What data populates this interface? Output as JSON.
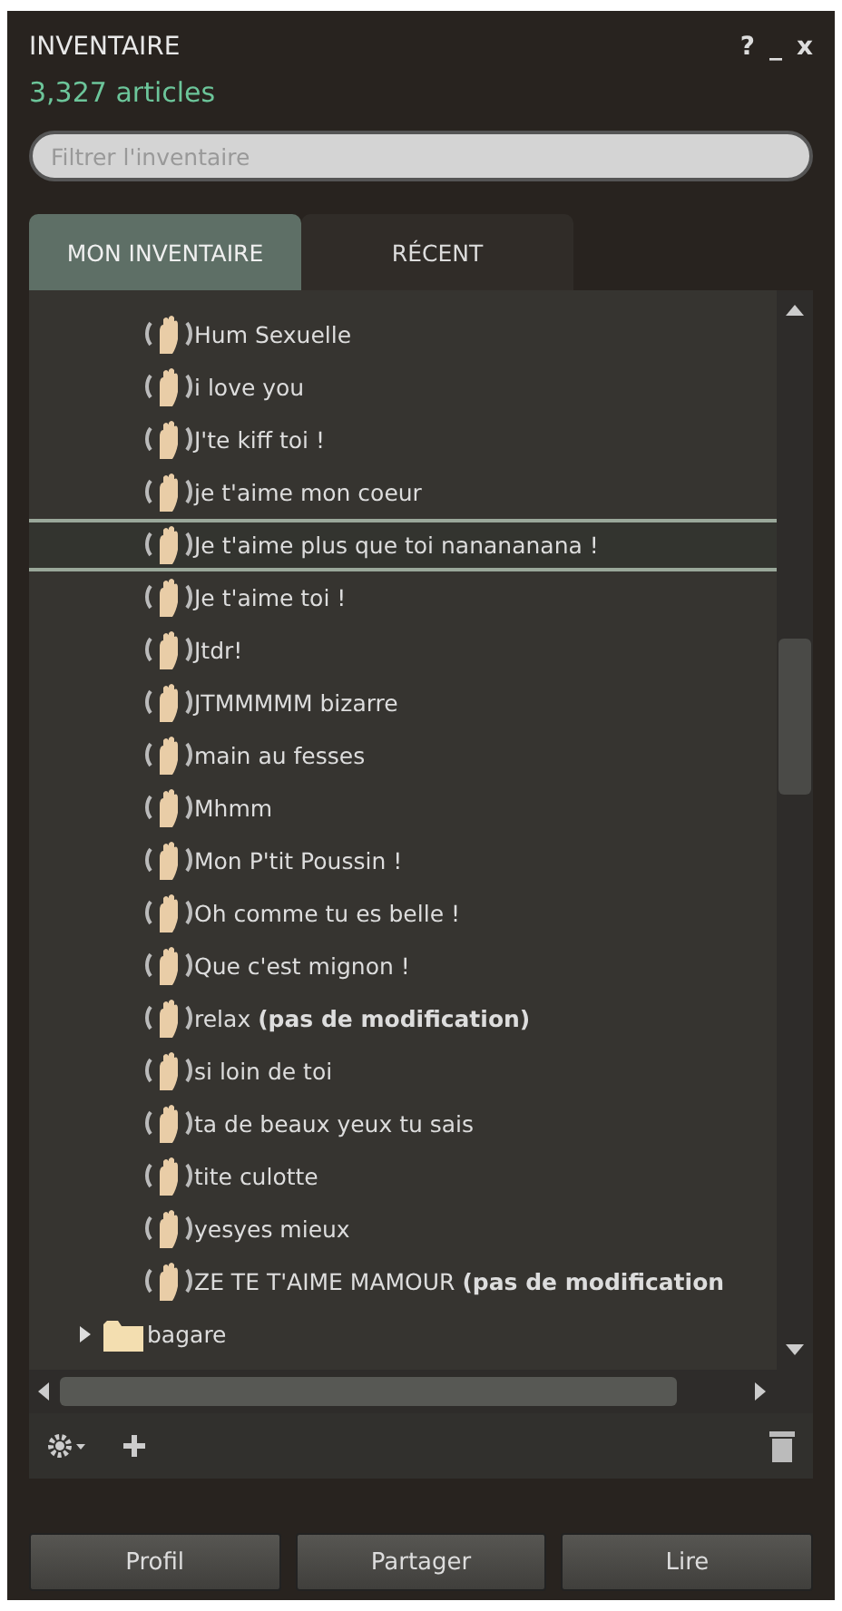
{
  "window": {
    "title": "INVENTAIRE",
    "controls": [
      "?",
      "_",
      "x"
    ]
  },
  "item_count": "3,327 articles",
  "filter": {
    "placeholder": "Filtrer l'inventaire"
  },
  "tabs": [
    {
      "label": "MON INVENTAIRE",
      "selected": true
    },
    {
      "label": "RÉCENT",
      "selected": false
    }
  ],
  "items": [
    {
      "kind": "gesture",
      "label": "Hum Sexuelle",
      "selected": false
    },
    {
      "kind": "gesture",
      "label": "i love you",
      "selected": false
    },
    {
      "kind": "gesture",
      "label": "J'te kiff toi !",
      "selected": false
    },
    {
      "kind": "gesture",
      "label": "je t'aime mon coeur",
      "selected": false
    },
    {
      "kind": "gesture",
      "label": "Je t'aime plus que toi nanananana !",
      "selected": true
    },
    {
      "kind": "gesture",
      "label": "Je t'aime toi !",
      "selected": false
    },
    {
      "kind": "gesture",
      "label": "Jtdr!",
      "selected": false
    },
    {
      "kind": "gesture",
      "label": "JTMMMMM bizarre",
      "selected": false
    },
    {
      "kind": "gesture",
      "label": "main au fesses",
      "selected": false
    },
    {
      "kind": "gesture",
      "label": "Mhmm",
      "selected": false
    },
    {
      "kind": "gesture",
      "label": "Mon P'tit Poussin !",
      "selected": false
    },
    {
      "kind": "gesture",
      "label": "Oh comme tu es belle !",
      "selected": false
    },
    {
      "kind": "gesture",
      "label": "Que c'est mignon !",
      "selected": false
    },
    {
      "kind": "gesture",
      "label": "relax **(pas de modification)**",
      "selected": false
    },
    {
      "kind": "gesture",
      "label": "si loin de toi",
      "selected": false
    },
    {
      "kind": "gesture",
      "label": "ta de beaux yeux tu sais",
      "selected": false
    },
    {
      "kind": "gesture",
      "label": "tite culotte",
      "selected": false
    },
    {
      "kind": "gesture",
      "label": "yesyes mieux",
      "selected": false
    },
    {
      "kind": "gesture",
      "label": "ZE TE T'AIME MAMOUR **(pas de modification**",
      "selected": false
    },
    {
      "kind": "folder",
      "label": "bagare",
      "selected": false,
      "expanded": false
    }
  ],
  "buttons": [
    "Profil",
    "Partager",
    "Lire"
  ]
}
